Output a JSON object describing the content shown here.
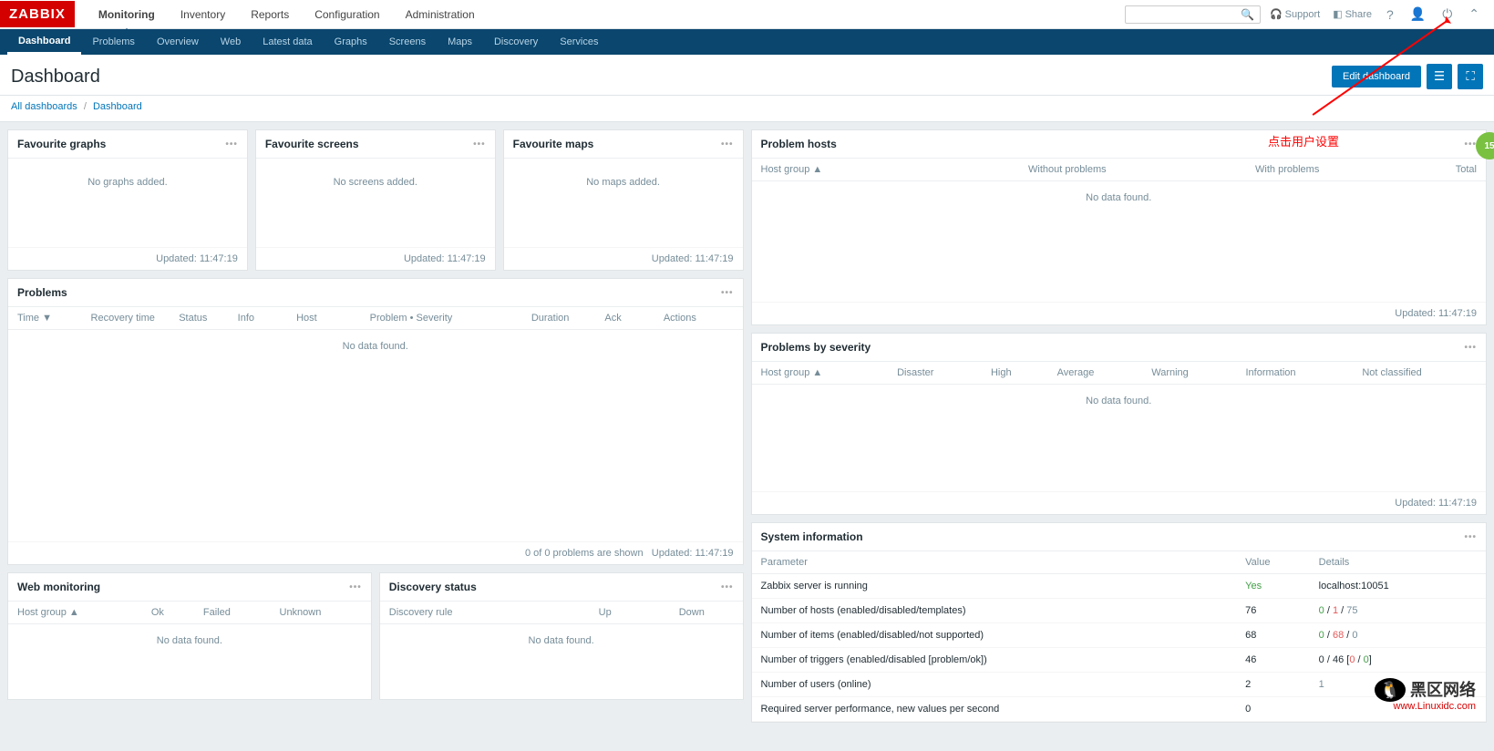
{
  "logo": "ZABBIX",
  "topnav": {
    "monitoring": "Monitoring",
    "inventory": "Inventory",
    "reports": "Reports",
    "configuration": "Configuration",
    "administration": "Administration"
  },
  "toptools": {
    "support": "Support",
    "share": "Share",
    "search_placeholder": ""
  },
  "subnav": {
    "dashboard": "Dashboard",
    "problems": "Problems",
    "overview": "Overview",
    "web": "Web",
    "latest": "Latest data",
    "graphs": "Graphs",
    "screens": "Screens",
    "maps": "Maps",
    "discovery": "Discovery",
    "services": "Services"
  },
  "page": {
    "title": "Dashboard",
    "edit_btn": "Edit dashboard",
    "breadcrumb_all": "All dashboards",
    "breadcrumb_current": "Dashboard"
  },
  "fav_graphs": {
    "title": "Favourite graphs",
    "empty": "No graphs added.",
    "updated": "Updated: 11:47:19"
  },
  "fav_screens": {
    "title": "Favourite screens",
    "empty": "No screens added.",
    "updated": "Updated: 11:47:19"
  },
  "fav_maps": {
    "title": "Favourite maps",
    "empty": "No maps added.",
    "updated": "Updated: 11:47:19"
  },
  "problems": {
    "title": "Problems",
    "cols": {
      "time": "Time ▼",
      "recovery": "Recovery time",
      "status": "Status",
      "info": "Info",
      "host": "Host",
      "problem": "Problem • Severity",
      "duration": "Duration",
      "ack": "Ack",
      "actions": "Actions"
    },
    "empty": "No data found.",
    "footer_count": "0 of 0 problems are shown",
    "updated": "Updated: 11:47:19"
  },
  "webmon": {
    "title": "Web monitoring",
    "cols": {
      "hostgroup": "Host group ▲",
      "ok": "Ok",
      "failed": "Failed",
      "unknown": "Unknown"
    },
    "empty": "No data found."
  },
  "discovery": {
    "title": "Discovery status",
    "cols": {
      "rule": "Discovery rule",
      "up": "Up",
      "down": "Down"
    },
    "empty": "No data found."
  },
  "phosts": {
    "title": "Problem hosts",
    "cols": {
      "hostgroup": "Host group ▲",
      "without": "Without problems",
      "with": "With problems",
      "total": "Total"
    },
    "empty": "No data found.",
    "updated": "Updated: 11:47:19"
  },
  "severity": {
    "title": "Problems by severity",
    "cols": {
      "hostgroup": "Host group ▲",
      "disaster": "Disaster",
      "high": "High",
      "average": "Average",
      "warning": "Warning",
      "information": "Information",
      "notclassified": "Not classified"
    },
    "empty": "No data found.",
    "updated": "Updated: 11:47:19"
  },
  "sysinfo": {
    "title": "System information",
    "cols": {
      "parameter": "Parameter",
      "value": "Value",
      "details": "Details"
    },
    "rows": [
      {
        "param": "Zabbix server is running",
        "value": "Yes",
        "value_class": "green",
        "details": "localhost:10051"
      },
      {
        "param": "Number of hosts (enabled/disabled/templates)",
        "value": "76",
        "details_parts": [
          {
            "t": "0",
            "c": "green"
          },
          {
            "t": " / "
          },
          {
            "t": "1",
            "c": "red"
          },
          {
            "t": " / "
          },
          {
            "t": "75",
            "c": "grey"
          }
        ]
      },
      {
        "param": "Number of items (enabled/disabled/not supported)",
        "value": "68",
        "details_parts": [
          {
            "t": "0",
            "c": "green"
          },
          {
            "t": " / "
          },
          {
            "t": "68",
            "c": "red"
          },
          {
            "t": " / "
          },
          {
            "t": "0",
            "c": "grey"
          }
        ]
      },
      {
        "param": "Number of triggers (enabled/disabled [problem/ok])",
        "value": "46",
        "details_parts": [
          {
            "t": "0 / 46 ["
          },
          {
            "t": "0",
            "c": "red"
          },
          {
            "t": " / "
          },
          {
            "t": "0",
            "c": "green"
          },
          {
            "t": "]"
          }
        ]
      },
      {
        "param": "Number of users (online)",
        "value": "2",
        "details": "1",
        "details_class": "grey"
      },
      {
        "param": "Required server performance, new values per second",
        "value": "0",
        "details": ""
      }
    ]
  },
  "annotation": "点击用户设置",
  "watermark_text": "黑区网络",
  "watermark_url": "www.Linuxidc.com",
  "badge": "15"
}
